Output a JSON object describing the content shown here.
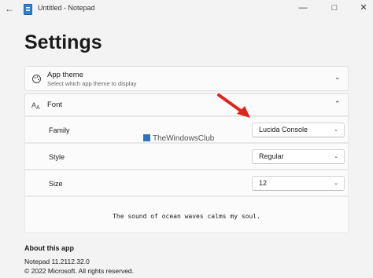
{
  "window": {
    "title": "Untitled - Notepad",
    "back_glyph": "←",
    "minimize_glyph": "—",
    "maximize_glyph": "□",
    "close_glyph": "✕"
  },
  "page": {
    "title": "Settings"
  },
  "app_theme": {
    "title": "App theme",
    "subtitle": "Select which app theme to display",
    "expand_glyph": "⌄"
  },
  "font": {
    "title": "Font",
    "collapse_glyph": "⌃",
    "rows": [
      {
        "label": "Family",
        "value": "Lucida Console"
      },
      {
        "label": "Style",
        "value": "Regular"
      },
      {
        "label": "Size",
        "value": "12"
      }
    ],
    "preview": "The sound of ocean waves calms my soul.",
    "dropdown_glyph": "⌄"
  },
  "annotation": {
    "arrow_color": "#e0241b"
  },
  "watermark": {
    "text": "TheWindowsClub"
  },
  "about": {
    "title": "About this app",
    "version": "Notepad 11.2112.32.0",
    "copyright": "© 2022 Microsoft. All rights reserved."
  },
  "colors": {
    "background": "#f3f3f3",
    "card": "#fbfbfb",
    "accent": "#2f80d8"
  }
}
